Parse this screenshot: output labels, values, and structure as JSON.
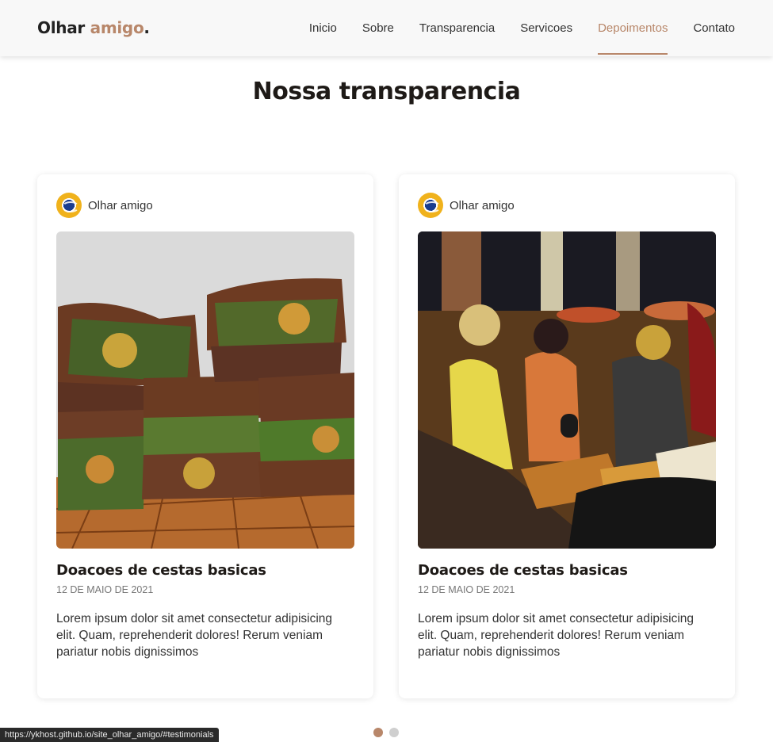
{
  "header": {
    "logo_main": "Olhar",
    "logo_accent": "amigo",
    "logo_dot": ".",
    "nav": [
      {
        "label": "Inicio"
      },
      {
        "label": "Sobre"
      },
      {
        "label": "Transparencia"
      },
      {
        "label": "Servicoes"
      },
      {
        "label": "Depoimentos",
        "active": true
      },
      {
        "label": "Contato"
      }
    ]
  },
  "colors": {
    "accent": "#b8876a",
    "title": "#1e1a17",
    "header_bg": "#f8f8f8",
    "dot_inactive": "#cfcfcf"
  },
  "section": {
    "title": "Nossa transparencia"
  },
  "cards": [
    {
      "author": "Olhar amigo",
      "avatar_icon": "eye-logo-icon",
      "image": "photo of stacked donation food bags on a tiled floor",
      "title": "Doacoes de cestas basicas",
      "date": "12 DE MAIO DE 2021",
      "text": "Lorem ipsum dolor sit amet consectetur adipisicing elit. Quam, reprehenderit dolores! Rerum veniam pariatur nobis dignissimos"
    },
    {
      "author": "Olhar amigo",
      "avatar_icon": "eye-logo-icon",
      "image": "night photo of volunteers serving food under an overpass",
      "title": "Doacoes de cestas basicas",
      "date": "12 DE MAIO DE 2021",
      "text": "Lorem ipsum dolor sit amet consectetur adipisicing elit. Quam, reprehenderit dolores! Rerum veniam pariatur nobis dignissimos"
    }
  ],
  "pagination": {
    "pages": 2,
    "active": 1
  },
  "statusbar": {
    "url": "https://ykhost.github.io/site_olhar_amigo/#testimonials"
  }
}
